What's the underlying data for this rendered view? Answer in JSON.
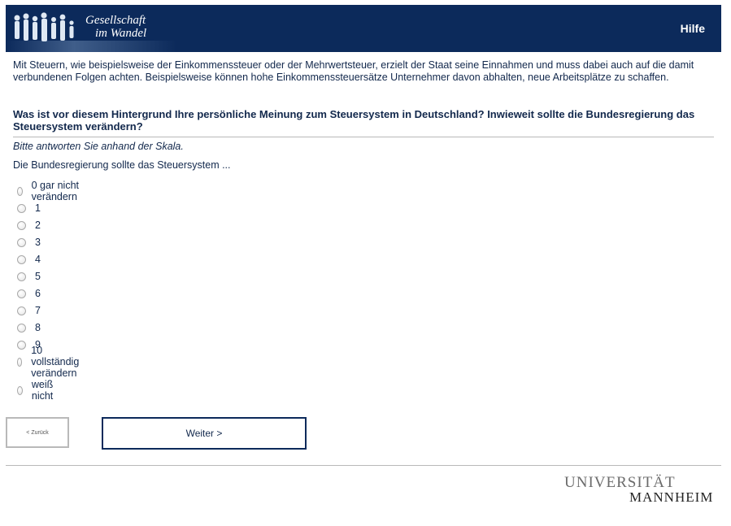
{
  "header": {
    "logo_line1": "Gesellschaft",
    "logo_line2": "im Wandel",
    "help_label": "Hilfe",
    "background_color": "#0c2a5b",
    "logo_icon": "people-silhouettes-icon"
  },
  "intro_text": "Mit Steuern, wie beispielsweise der Einkommenssteuer oder der Mehrwertsteuer, erzielt der Staat seine Einnahmen und muss dabei auch auf die damit verbundenen Folgen achten. Beispielsweise können hohe Einkommenssteuersätze Unternehmer davon abhalten, neue Arbeitsplätze zu schaffen.",
  "question_text": "Was ist vor diesem Hintergrund Ihre persönliche Meinung zum Steuersystem in Deutschland? Inwieweit sollte die Bundesregierung das Steuersystem verändern?",
  "instruction_text": "Bitte antworten Sie anhand der Skala.",
  "stem_text": "Die Bundesregierung sollte das Steuersystem ...",
  "options": [
    {
      "label": "0 gar nicht verändern"
    },
    {
      "label": "1"
    },
    {
      "label": "2"
    },
    {
      "label": "3"
    },
    {
      "label": "4"
    },
    {
      "label": "5"
    },
    {
      "label": "6"
    },
    {
      "label": "7"
    },
    {
      "label": "8"
    },
    {
      "label": "9"
    },
    {
      "label": "10 vollständig verändern"
    },
    {
      "label": "weiß nicht"
    }
  ],
  "buttons": {
    "back_label": "< Zurück",
    "next_label": "Weiter >"
  },
  "footer": {
    "uni_line1": "UNIVERSITÄT",
    "uni_line2": "MANNHEIM"
  }
}
